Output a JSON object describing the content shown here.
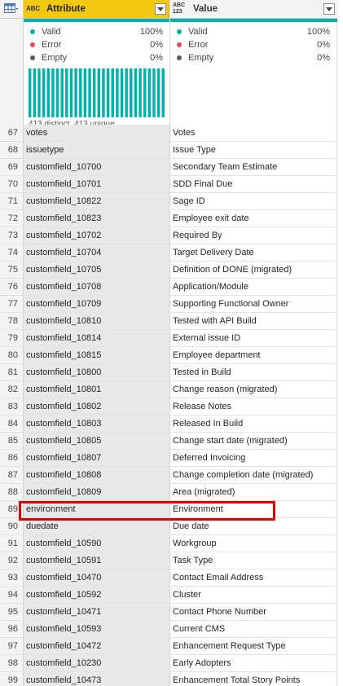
{
  "columns": {
    "attribute": {
      "type_badge": "ABC",
      "title": "Attribute"
    },
    "value": {
      "type_badge_top": "ABC",
      "type_badge_bottom": "123",
      "title": "Value"
    }
  },
  "profile": {
    "attribute": {
      "valid_label": "Valid",
      "valid_pct": "100%",
      "error_label": "Error",
      "error_pct": "0%",
      "empty_label": "Empty",
      "empty_pct": "0%",
      "summary": "413 distinct, 413 unique",
      "histogram_bar_count": 30,
      "valid_fraction": 1.0
    },
    "value": {
      "valid_label": "Valid",
      "valid_pct": "100%",
      "error_label": "Error",
      "error_pct": "0%",
      "empty_label": "Empty",
      "empty_pct": "0%",
      "valid_fraction": 1.0
    }
  },
  "colors": {
    "valid": "#00b2a9",
    "error": "#e8475b",
    "empty": "#595959",
    "header_active": "#f2c811",
    "highlight": "#e00000"
  },
  "rows": [
    {
      "n": "67",
      "attr": "votes",
      "val": "Votes"
    },
    {
      "n": "68",
      "attr": "issuetype",
      "val": "Issue Type"
    },
    {
      "n": "69",
      "attr": "customfield_10700",
      "val": "Secondary Team Estimate"
    },
    {
      "n": "70",
      "attr": "customfield_10701",
      "val": "SDD Final Due"
    },
    {
      "n": "71",
      "attr": "customfield_10822",
      "val": "Sage ID"
    },
    {
      "n": "72",
      "attr": "customfield_10823",
      "val": "Employee exit date"
    },
    {
      "n": "73",
      "attr": "customfield_10702",
      "val": "Required By"
    },
    {
      "n": "74",
      "attr": "customfield_10704",
      "val": "Target Delivery Date"
    },
    {
      "n": "75",
      "attr": "customfield_10705",
      "val": "Definition of DONE (migrated)"
    },
    {
      "n": "76",
      "attr": "customfield_10708",
      "val": "Application/Module"
    },
    {
      "n": "77",
      "attr": "customfield_10709",
      "val": "Supporting Functional Owner"
    },
    {
      "n": "78",
      "attr": "customfield_10810",
      "val": "Tested with API Build"
    },
    {
      "n": "79",
      "attr": "customfield_10814",
      "val": "External issue ID"
    },
    {
      "n": "80",
      "attr": "customfield_10815",
      "val": "Employee department"
    },
    {
      "n": "81",
      "attr": "customfield_10800",
      "val": "Tested in Build"
    },
    {
      "n": "82",
      "attr": "customfield_10801",
      "val": "Change reason (migrated)"
    },
    {
      "n": "83",
      "attr": "customfield_10802",
      "val": "Release Notes"
    },
    {
      "n": "84",
      "attr": "customfield_10803",
      "val": "Released In Build"
    },
    {
      "n": "85",
      "attr": "customfield_10805",
      "val": "Change start date (migrated)"
    },
    {
      "n": "86",
      "attr": "customfield_10807",
      "val": "Deferred Invoicing"
    },
    {
      "n": "87",
      "attr": "customfield_10808",
      "val": "Change completion date (migrated)"
    },
    {
      "n": "88",
      "attr": "customfield_10809",
      "val": "Area (migrated)"
    },
    {
      "n": "89",
      "attr": "environment",
      "val": "Environment"
    },
    {
      "n": "90",
      "attr": "duedate",
      "val": "Due date"
    },
    {
      "n": "91",
      "attr": "customfield_10590",
      "val": "Workgroup"
    },
    {
      "n": "92",
      "attr": "customfield_10591",
      "val": "Task Type"
    },
    {
      "n": "93",
      "attr": "customfield_10470",
      "val": "Contact Email Address"
    },
    {
      "n": "94",
      "attr": "customfield_10592",
      "val": "Cluster"
    },
    {
      "n": "95",
      "attr": "customfield_10471",
      "val": "Contact Phone Number"
    },
    {
      "n": "96",
      "attr": "customfield_10593",
      "val": "Current CMS"
    },
    {
      "n": "97",
      "attr": "customfield_10472",
      "val": "Enhancement Request Type"
    },
    {
      "n": "98",
      "attr": "customfield_10230",
      "val": "Early Adopters"
    },
    {
      "n": "99",
      "attr": "customfield_10473",
      "val": "Enhancement Total Story Points"
    }
  ]
}
